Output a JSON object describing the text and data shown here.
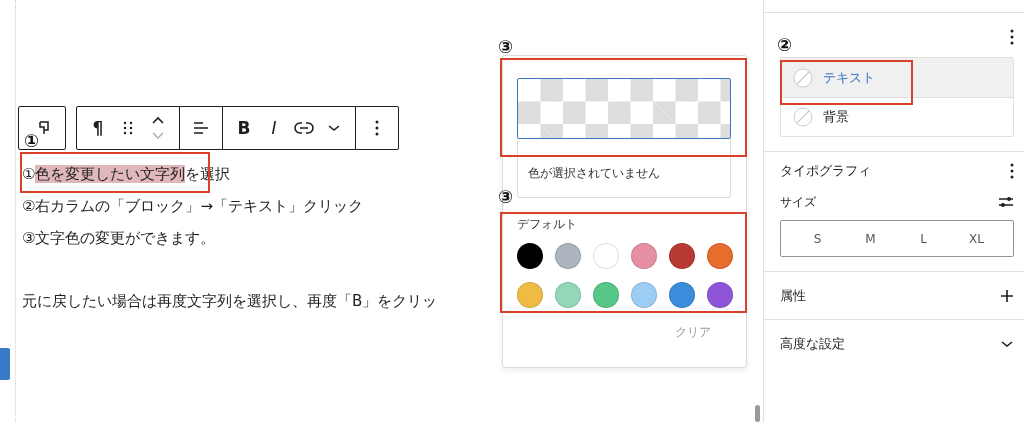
{
  "editor": {
    "toolbar": [
      {
        "kind": "transform"
      },
      {
        "kind": "glyph",
        "label": "¶"
      },
      {
        "kind": "drag"
      },
      {
        "kind": "mover"
      },
      {
        "kind": "align"
      },
      {
        "kind": "glyph",
        "label": "B"
      },
      {
        "kind": "italic",
        "label": "I"
      },
      {
        "kind": "link"
      },
      {
        "kind": "more"
      },
      {
        "kind": "options"
      }
    ],
    "paragraphs": [
      {
        "before": "①",
        "highlight": "色を変更したい文字列",
        "after": "を選択"
      },
      {
        "before": "②右カラムの「ブロック」→「テキスト」クリック"
      },
      {
        "before": "③文字色の変更ができます。"
      },
      {
        "before": "元に戻したい場合は再度文字列を選択し、再度「B」をクリッ"
      }
    ]
  },
  "color_popover": {
    "status": "色が選択されていません",
    "palette_title": "デフォルト",
    "palette": [
      {
        "color": "#000000"
      },
      {
        "color": "#abb4bd"
      },
      {
        "color": "#ffffff"
      },
      {
        "color": "#e58ea4"
      },
      {
        "color": "#b93a35"
      },
      {
        "color": "#e86c2c"
      },
      {
        "color": "#f0bb42"
      },
      {
        "color": "#92d8b8"
      },
      {
        "color": "#56c786"
      },
      {
        "color": "#9ccdf5"
      },
      {
        "color": "#3a8ddb"
      },
      {
        "color": "#8f55d6"
      }
    ],
    "clear_button": "クリア"
  },
  "sidebar": {
    "color_items": [
      {
        "label": "テキスト",
        "selected": true
      },
      {
        "label": "背景",
        "selected": false
      }
    ],
    "typography": {
      "title": "タイポグラフィ",
      "size_label": "サイズ",
      "sizes": [
        {
          "label": "S",
          "selected": false
        },
        {
          "label": "M",
          "selected": false
        },
        {
          "label": "L",
          "selected": false
        },
        {
          "label": "XL",
          "selected": false
        }
      ]
    },
    "sections": [
      {
        "title": "属性",
        "kind": "add"
      },
      {
        "title": "高度な設定",
        "kind": "chevron"
      }
    ]
  },
  "annotations": [
    {
      "label": "①"
    },
    {
      "label": "②"
    },
    {
      "label": "③"
    },
    {
      "label": "③"
    }
  ]
}
